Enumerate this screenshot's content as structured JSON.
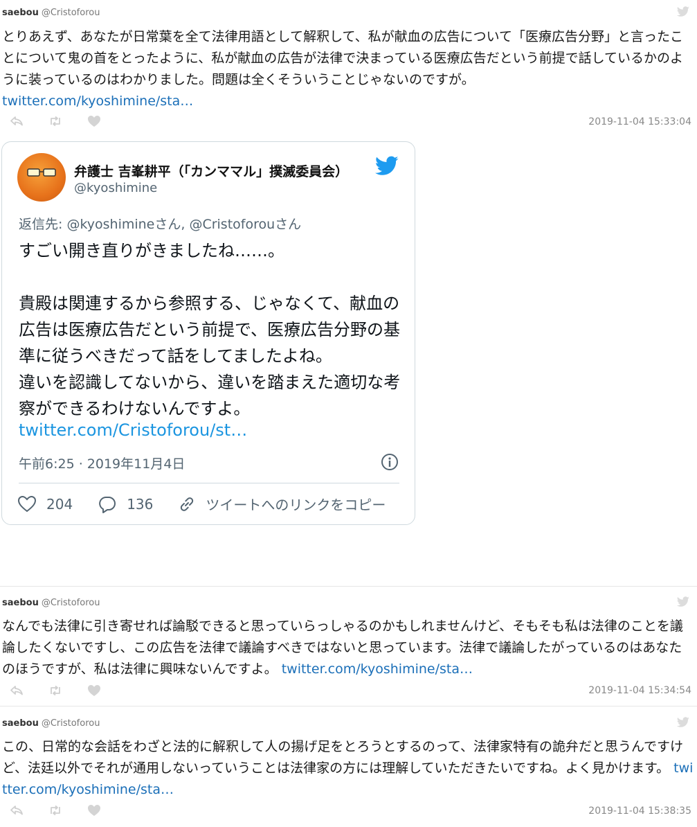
{
  "tweets": [
    {
      "name": "saebou",
      "handle": "@Cristoforou",
      "text": "とりあえず、あなたが日常葉を全て法律用語として解釈して、私が献血の広告について「医療広告分野」と言ったことについて鬼の首をとったように、私が献血の広告が法律で決まっている医療広告だという前提で話しているかのように装っているのはわかりました。問題は全くそういうことじゃないのですが。",
      "link": "twitter.com/kyoshimine/sta…",
      "timestamp": "2019-11-04 15:33:04"
    },
    {
      "name": "saebou",
      "handle": "@Cristoforou",
      "text": "なんでも法律に引き寄せれば論駁できると思っていらっしゃるのかもしれませんけど、そもそも私は法律のことを議論したくないですし、この広告を法律で議論すべきではないと思っています。法律で議論したがっているのはあなたのほうですが、私は法律に興味ないんですよ。",
      "link": "twitter.com/kyoshimine/sta…",
      "timestamp": "2019-11-04 15:34:54"
    },
    {
      "name": "saebou",
      "handle": "@Cristoforou",
      "text": "この、日常的な会話をわざと法的に解釈して人の揚げ足をとろうとするのって、法律家特有の詭弁だと思うんですけど、法廷以外でそれが通用しないっていうことは法律家の方には理解していただきたいですね。よく見かけます。",
      "link": "twitter.com/kyoshimine/sta…",
      "timestamp": "2019-11-04 15:38:35"
    }
  ],
  "embed": {
    "name": "弁護士 吉峯耕平（「カンママル」撲滅委員会）",
    "handle": "@kyoshimine",
    "reply_to": "返信先: @kyoshimineさん, @Cristoforouさん",
    "body": "すごい開き直りがきましたね……。\n\n貴殿は関連するから参照する、じゃなくて、献血の広告は医療広告だという前提で、医療広告分野の基準に従うべきだって話をしてましたよね。\n違いを認識してないから、違いを踏まえた適切な考察ができるわけないんですよ。",
    "link": "twitter.com/Cristoforou/st…",
    "date": "午前6:25 · 2019年11月4日",
    "likes": "204",
    "replies": "136",
    "copy_link": "ツイートへのリンクをコピー"
  },
  "icons": {
    "reply": "reply-icon",
    "retweet": "retweet-icon",
    "like": "heart-icon",
    "bird": "twitter-bird-icon",
    "info": "info-icon",
    "comment": "comment-icon",
    "link": "link-icon"
  },
  "colors": {
    "link": "#1b6fb8",
    "embed_link": "#1b95e0",
    "twitter_blue": "#1d9bf0",
    "muted": "#888888"
  }
}
